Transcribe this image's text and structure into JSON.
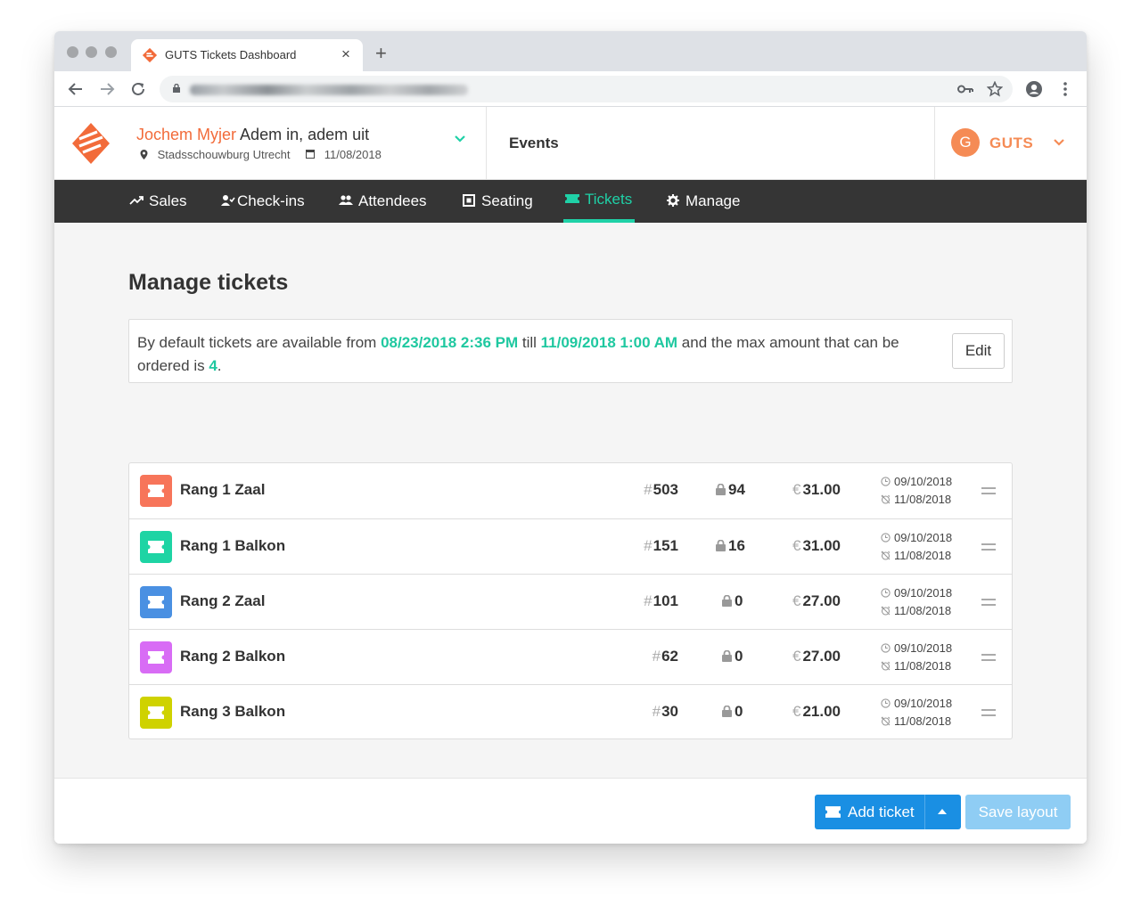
{
  "browser": {
    "tab_title": "GUTS Tickets Dashboard",
    "tab_close": "×",
    "new_tab": "+"
  },
  "header": {
    "artist": "Jochem Myjer",
    "show_title": "Adem in, adem uit",
    "venue": "Stadsschouwburg Utrecht",
    "date": "11/08/2018",
    "events_label": "Events",
    "org_initial": "G",
    "org_name": "GUTS"
  },
  "nav": {
    "items": [
      {
        "label": "Sales",
        "icon": "trend-icon"
      },
      {
        "label": "Check-ins",
        "icon": "user-check-icon"
      },
      {
        "label": "Attendees",
        "icon": "users-icon"
      },
      {
        "label": "Seating",
        "icon": "seat-icon"
      },
      {
        "label": "Tickets",
        "icon": "ticket-icon",
        "active": true
      },
      {
        "label": "Manage",
        "icon": "gear-icon"
      }
    ]
  },
  "main": {
    "title": "Manage tickets",
    "info": {
      "prefix": "By default tickets are available from ",
      "start": "08/23/2018 2:36 PM",
      "mid": " till ",
      "end": "11/09/2018 1:00 AM",
      "suffix": " and the max amount that can be ordered is ",
      "max": "4",
      "period": "."
    },
    "edit_label": "Edit"
  },
  "tickets": [
    {
      "name": "Rang 1 Zaal",
      "count": "503",
      "locked": "94",
      "price": "31.00",
      "from": "09/10/2018",
      "until": "11/08/2018",
      "color": "#f7755a"
    },
    {
      "name": "Rang 1 Balkon",
      "count": "151",
      "locked": "16",
      "price": "31.00",
      "from": "09/10/2018",
      "until": "11/08/2018",
      "color": "#1ed4a4"
    },
    {
      "name": "Rang 2 Zaal",
      "count": "101",
      "locked": "0",
      "price": "27.00",
      "from": "09/10/2018",
      "until": "11/08/2018",
      "color": "#4a90e2"
    },
    {
      "name": "Rang 2 Balkon",
      "count": "62",
      "locked": "0",
      "price": "27.00",
      "from": "09/10/2018",
      "until": "11/08/2018",
      "color": "#d86cf5"
    },
    {
      "name": "Rang 3 Balkon",
      "count": "30",
      "locked": "0",
      "price": "21.00",
      "from": "09/10/2018",
      "until": "11/08/2018",
      "color": "#cfd200"
    }
  ],
  "symbols": {
    "hash": "#",
    "euro": "€"
  },
  "footer": {
    "add_label": "Add ticket",
    "save_label": "Save layout"
  },
  "colors": {
    "accent": "#1fd1a7",
    "brand": "#f26b3a",
    "primary": "#1a8fe3",
    "nav_bg": "#353535"
  }
}
